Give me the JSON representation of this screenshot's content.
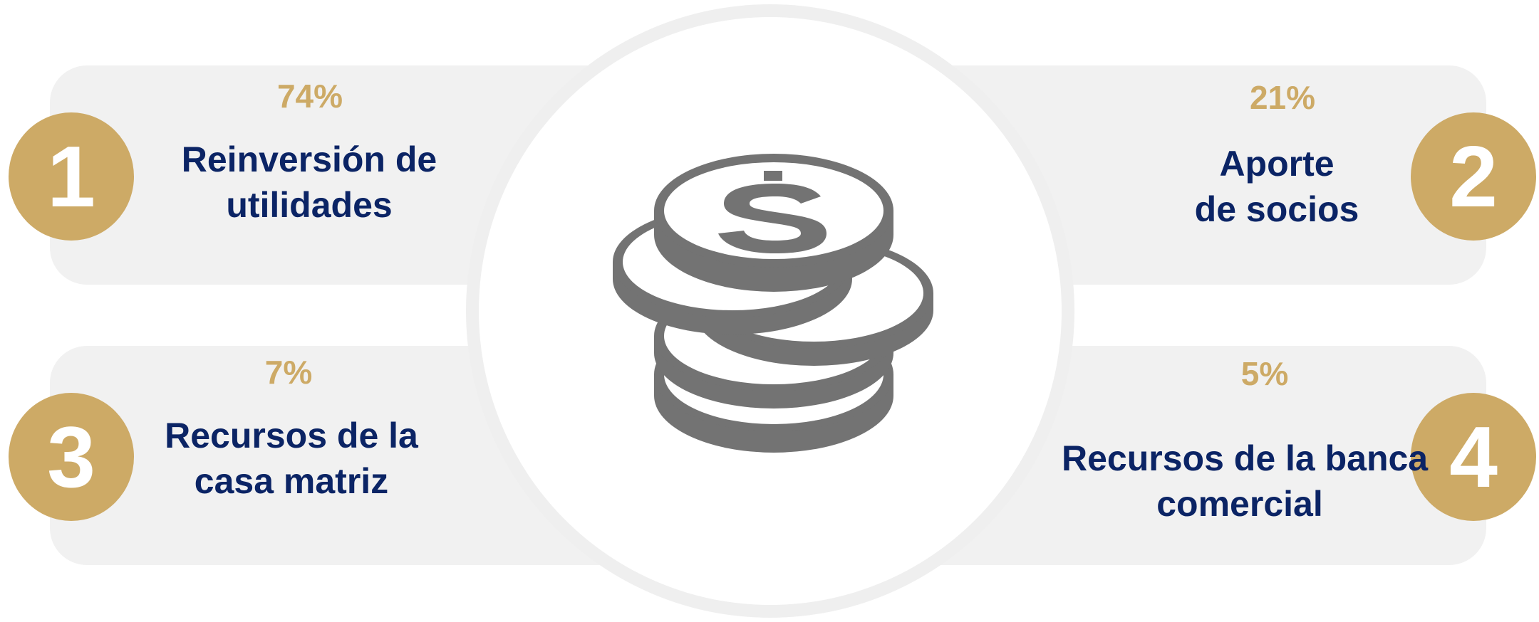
{
  "items": [
    {
      "number": "1",
      "percent": "74%",
      "label_line1": "Reinversión de",
      "label_line2": "utilidades"
    },
    {
      "number": "2",
      "percent": "21%",
      "label_line1": "Aporte",
      "label_line2": "de socios"
    },
    {
      "number": "3",
      "percent": "7%",
      "label_line1": "Recursos de la",
      "label_line2": "casa matriz"
    },
    {
      "number": "4",
      "percent": "5%",
      "label_line1": "Recursos de la banca",
      "label_line2": "comercial"
    }
  ],
  "center_icon": "coin-stack-dollar-icon",
  "colors": {
    "gold": "#cdaa66",
    "navy": "#0b2465",
    "card_bg": "#f1f1f1",
    "icon_gray": "#737373"
  }
}
